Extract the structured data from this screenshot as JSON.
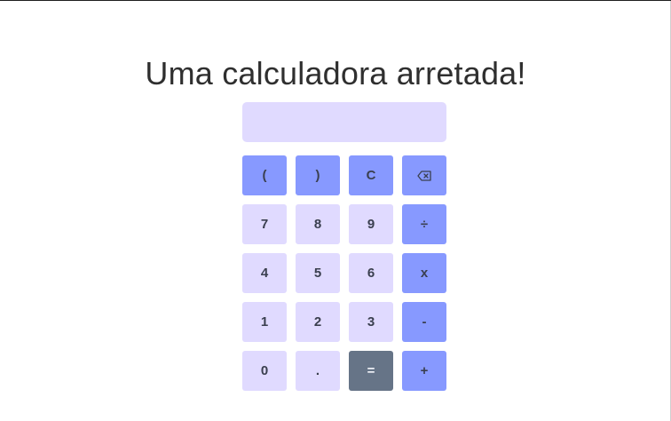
{
  "title": "Uma calculadora arretada!",
  "display": {
    "value": ""
  },
  "keys": {
    "open_paren": "(",
    "close_paren": ")",
    "clear": "C",
    "backspace_icon": "backspace-icon",
    "seven": "7",
    "eight": "8",
    "nine": "9",
    "divide": "÷",
    "four": "4",
    "five": "5",
    "six": "6",
    "multiply": "x",
    "one": "1",
    "two": "2",
    "three": "3",
    "minus": "-",
    "zero": "0",
    "dot": ".",
    "equals": "=",
    "plus": "+"
  },
  "colors": {
    "display_bg": "#e0daff",
    "number_key": "#e0daff",
    "operator_key": "#8799ff",
    "equals_key": "#667487",
    "text": "#2f2f2f"
  }
}
